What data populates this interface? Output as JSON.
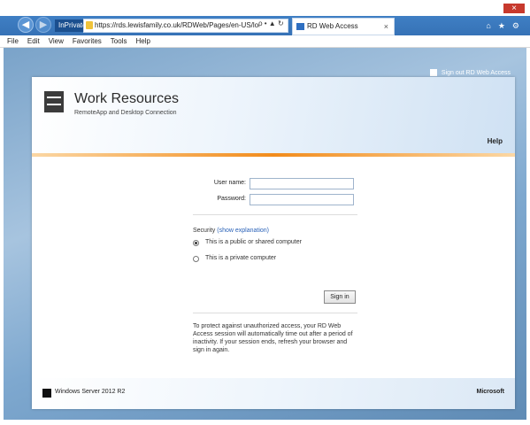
{
  "browser": {
    "inprivate_label": "InPrivate",
    "address": "https://rds.lewisfamily.co.uk/RDWeb/Pages/en-US/lo",
    "address_controls": "ρ • ▲ ↻",
    "tab_title": "RD Web Access",
    "tab_close": "×",
    "menu": [
      "File",
      "Edit",
      "View",
      "Favorites",
      "Tools",
      "Help"
    ],
    "window_buttons": [
      "–",
      "□",
      "×"
    ],
    "toolbar_icons": [
      "⌂",
      "★",
      "⚙"
    ]
  },
  "page": {
    "sign_out": "Sign out RD Web Access",
    "title": "Work Resources",
    "subtitle": "RemoteApp and Desktop Connection",
    "help": "Help",
    "form": {
      "username_label": "User name:",
      "username_value": "",
      "password_label": "Password:",
      "password_value": "",
      "security_label": "Security",
      "security_link": "(show explanation)",
      "option_public": "This is a public or shared computer",
      "option_private": "This is a private computer",
      "selected_option": "public",
      "sign_in": "Sign in"
    },
    "notice": "To protect against unauthorized access, your RD Web Access session will automatically time out after a period of inactivity. If your session ends, refresh your browser and sign in again.",
    "footer_os": "Windows Server 2012 R2",
    "footer_brand": "Microsoft"
  }
}
